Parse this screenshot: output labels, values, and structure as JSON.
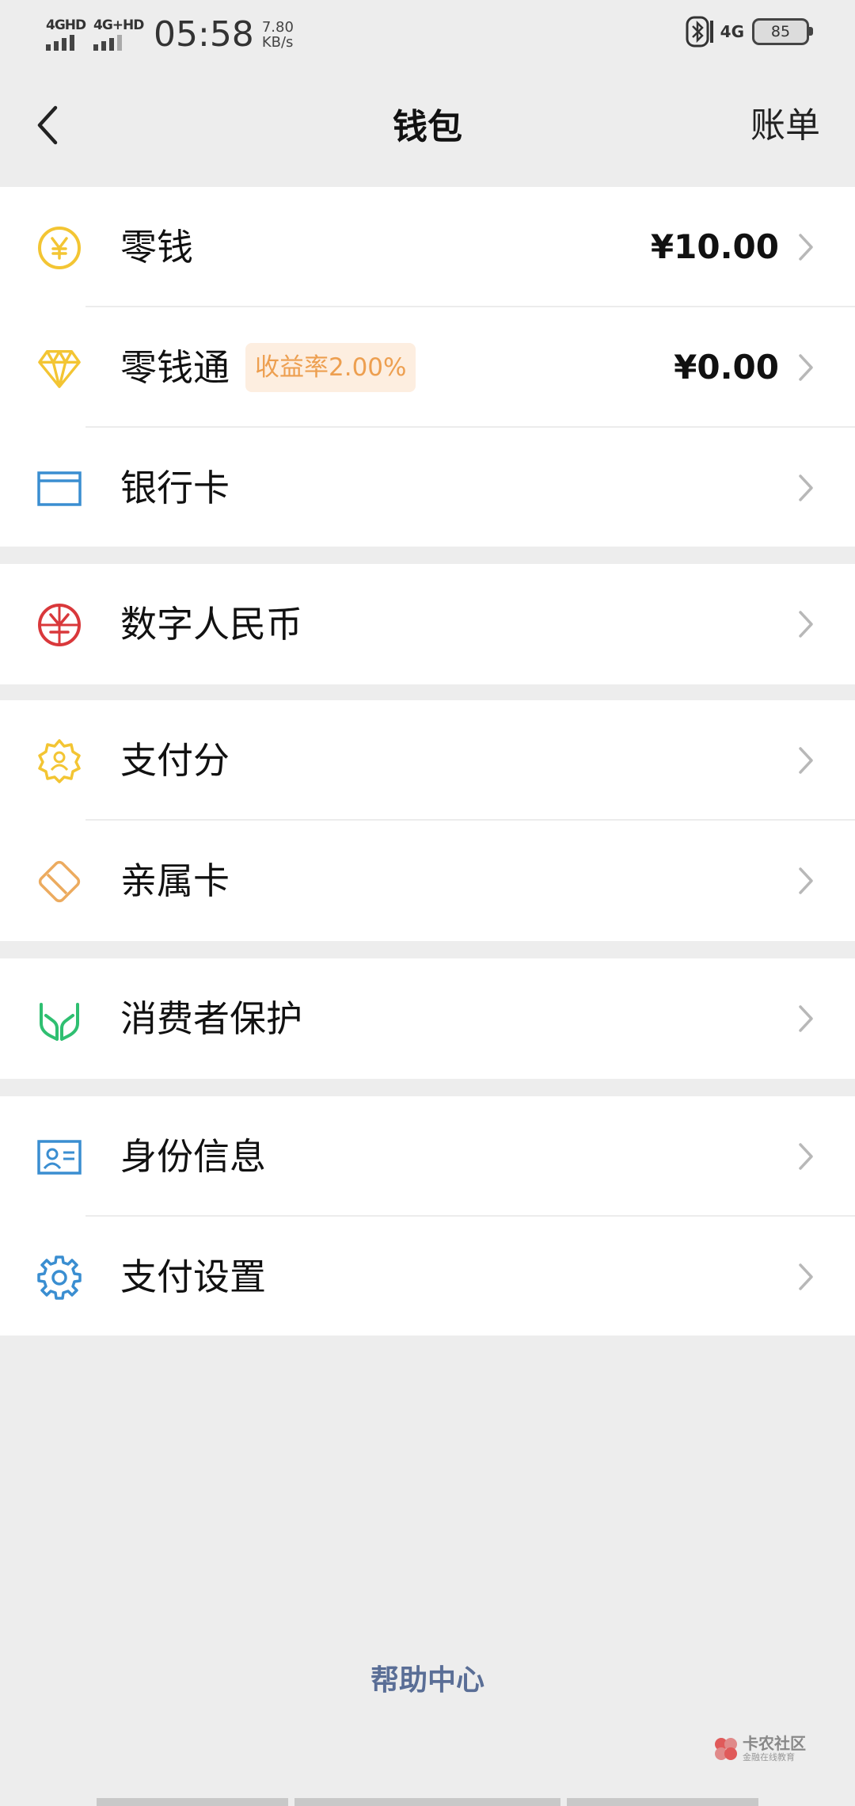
{
  "status_bar": {
    "sim1": "4GHD",
    "sim2": "4G+HD",
    "time": "05:58",
    "speed_value": "7.80",
    "speed_unit": "KB/s",
    "network": "4G",
    "battery": "85"
  },
  "navbar": {
    "title": "钱包",
    "right_label": "账单"
  },
  "groups": {
    "g1": {
      "change": {
        "label": "零钱",
        "value": "¥10.00"
      },
      "change_plus": {
        "label": "零钱通",
        "badge": "收益率2.00%",
        "value": "¥0.00"
      },
      "bank_card": {
        "label": "银行卡"
      }
    },
    "g2": {
      "digital_rmb": {
        "label": "数字人民币"
      }
    },
    "g3": {
      "pay_score": {
        "label": "支付分"
      },
      "family_card": {
        "label": "亲属卡"
      }
    },
    "g4": {
      "consumer_protection": {
        "label": "消费者保护"
      }
    },
    "g5": {
      "identity": {
        "label": "身份信息"
      },
      "pay_settings": {
        "label": "支付设置"
      }
    }
  },
  "footer": {
    "help": "帮助中心"
  },
  "watermark": {
    "name": "卡农社区",
    "sub": "金融在线教育"
  },
  "colors": {
    "yellow": "#f3c533",
    "red": "#d9383b",
    "blue": "#3a8ed1",
    "orange": "#ecab5f",
    "green": "#2fbf71",
    "link": "#5a6e96"
  },
  "icons": {
    "change": "yen-coin-icon",
    "change_plus": "diamond-icon",
    "bank_card": "card-icon",
    "digital_rmb": "digital-rmb-icon",
    "pay_score": "badge-star-icon",
    "family_card": "family-card-icon",
    "consumer_protection": "hands-icon",
    "identity": "id-card-icon",
    "pay_settings": "gear-icon"
  }
}
